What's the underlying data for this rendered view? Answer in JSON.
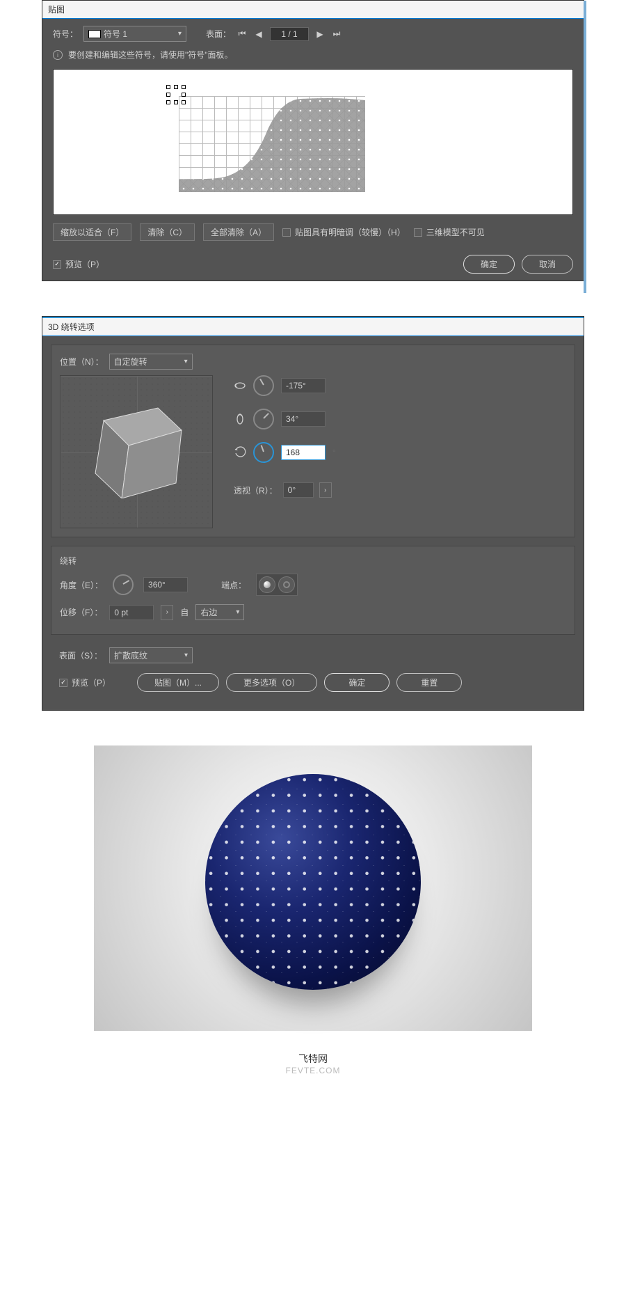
{
  "panel1": {
    "title": "贴图",
    "symbol_label": "符号：",
    "symbol_select": "符号 1",
    "surface_label": "表面：",
    "page_value": "1 / 1",
    "info_text": "要创建和编辑这些符号，请使用\"符号\"面板。",
    "buttons": {
      "scale": "缩放以适合（F）",
      "clear": "清除（C）",
      "clear_all": "全部清除（A）"
    },
    "checks": {
      "shading": "贴图具有明暗调（较慢）（H）",
      "invisible": "三维模型不可见",
      "preview": "预览（P）"
    },
    "ok": "确定",
    "cancel": "取消"
  },
  "panel2": {
    "title": "3D 绕转选项",
    "position_label": "位置（N）：",
    "position_value": "自定旋转",
    "rotx": "-175°",
    "roty": "34°",
    "rotz": "168",
    "perspective_label": "透视（R）：",
    "perspective_value": "0°",
    "revolve_label": "绕转",
    "angle_label": "角度（E）：",
    "angle_value": "360°",
    "cap_label": "端点：",
    "offset_label": "位移（F）：",
    "offset_value": "0 pt",
    "from_label": "自",
    "from_value": "右边",
    "surface_label": "表面（S）：",
    "surface_value": "扩散底纹",
    "preview": "预览（P）",
    "map": "贴图（M）...",
    "more": "更多选项（O）",
    "ok": "确定",
    "reset": "重置"
  },
  "caption": {
    "title": "飞特网",
    "sub": "FEVTE.COM"
  }
}
